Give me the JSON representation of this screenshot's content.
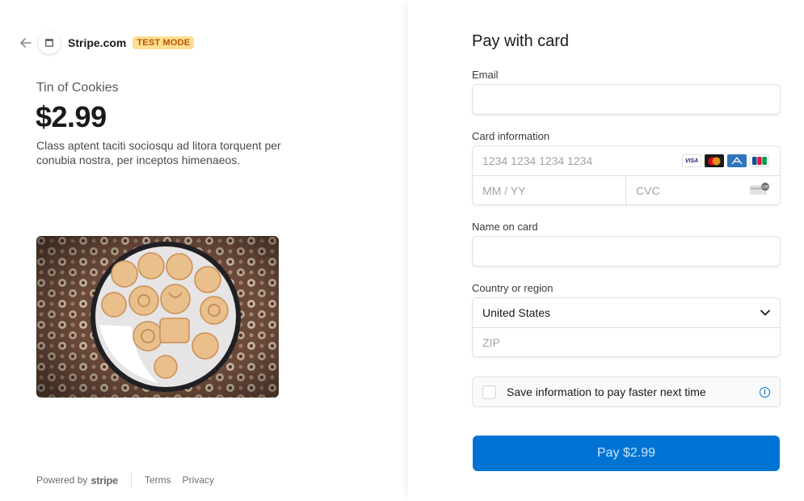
{
  "header": {
    "merchant": "Stripe.com",
    "badge": "TEST MODE"
  },
  "product": {
    "name": "Tin of Cookies",
    "price": "$2.99",
    "description": "Class aptent taciti sociosqu ad litora torquent per conubia nostra, per inceptos himenaeos."
  },
  "footer": {
    "powered_by": "Powered by",
    "brand": "stripe",
    "terms": "Terms",
    "privacy": "Privacy"
  },
  "form": {
    "title": "Pay with card",
    "email_label": "Email",
    "email_value": "",
    "card_label": "Card information",
    "card_number_placeholder": "1234 1234 1234 1234",
    "expiry_placeholder": "MM / YY",
    "cvc_placeholder": "CVC",
    "card_brands": [
      "VISA",
      "mastercard",
      "AMEX",
      "JCB"
    ],
    "name_label": "Name on card",
    "name_value": "",
    "country_label": "Country or region",
    "country_value": "United States",
    "zip_placeholder": "ZIP",
    "save_label": "Save information to pay faster next time",
    "save_checked": false,
    "pay_label": "Pay $2.99"
  },
  "colors": {
    "accent": "#0074d4",
    "badge_bg": "#ffde92",
    "badge_text": "#bb5504"
  }
}
